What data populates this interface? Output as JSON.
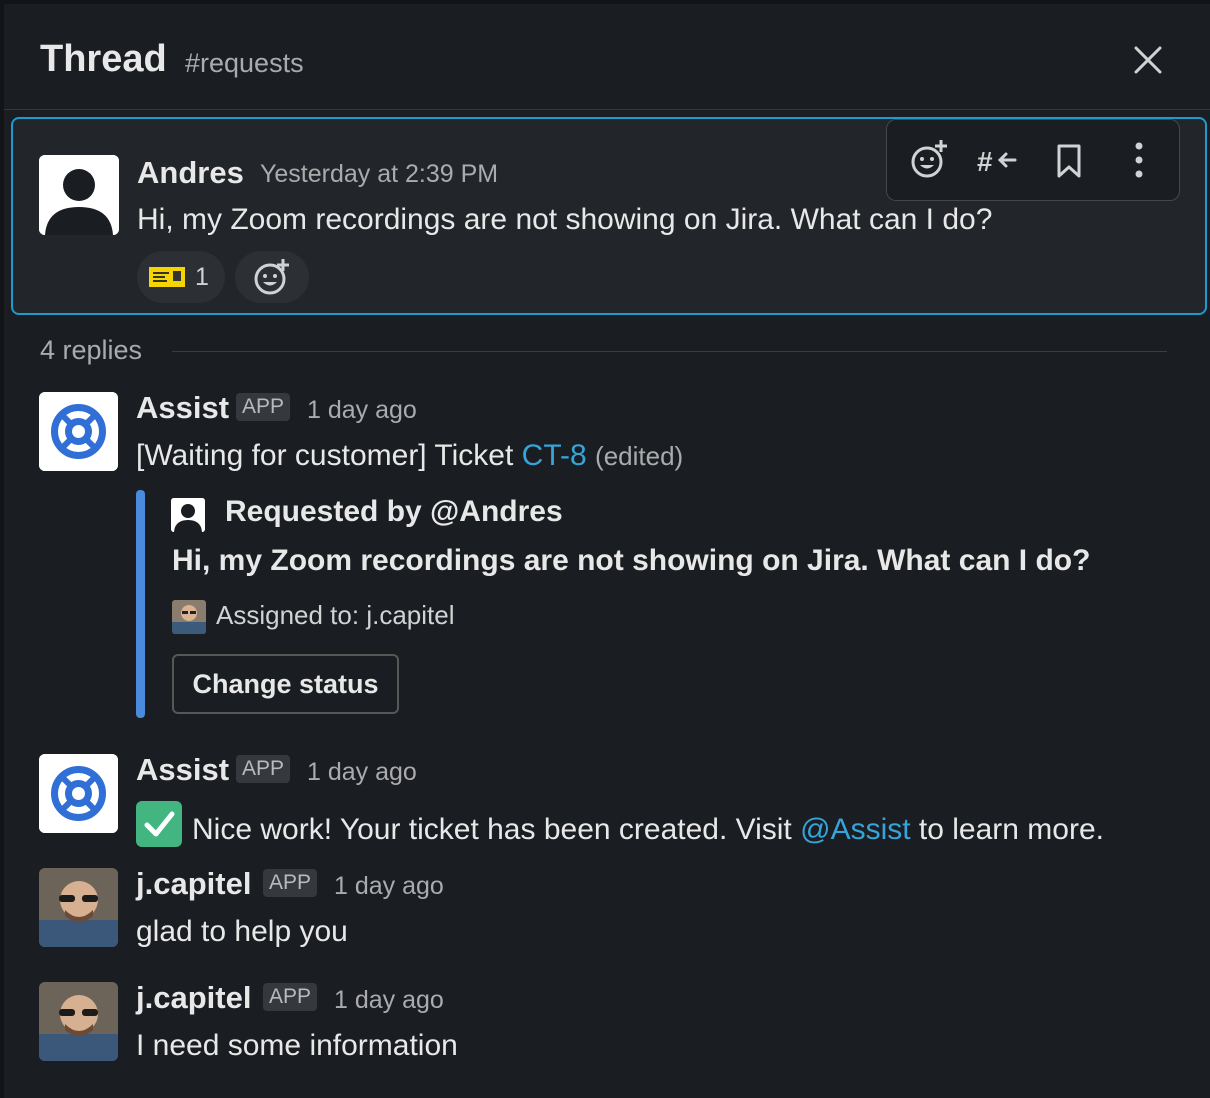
{
  "header": {
    "title": "Thread",
    "channel": "#requests"
  },
  "parent": {
    "author": "Andres",
    "time": "Yesterday at 2:39 PM",
    "text": "Hi, my Zoom recordings are not showing on Jira. What can I do?",
    "reaction": {
      "emoji": "ticket-icon",
      "count": "1"
    }
  },
  "toolbar": [
    "add-reaction-icon",
    "share-to-channel-icon",
    "bookmark-icon",
    "more-actions-icon"
  ],
  "replies": {
    "count_label": "4 replies"
  },
  "messages": [
    {
      "author": "Assist",
      "badge": "APP",
      "time": "1 day ago",
      "text_prefix": "[Waiting for customer] Ticket ",
      "ticket_link": "CT-8",
      "edited": "(edited)",
      "attachment": {
        "requested": "Requested by @Andres",
        "body": "Hi, my Zoom recordings are not showing on Jira. What can I do?",
        "assigned": "Assigned to: j.capitel",
        "button": "Change status"
      }
    },
    {
      "author": "Assist",
      "badge": "APP",
      "time": "1 day ago",
      "text_prefix": "Nice work! Your ticket has been created. Visit ",
      "mention": "@Assist",
      "text_suffix": " to learn more."
    },
    {
      "author": "j.capitel",
      "badge": "APP",
      "time": "1 day ago",
      "text": "glad to help you"
    },
    {
      "author": "j.capitel",
      "badge": "APP",
      "time": "1 day ago",
      "text": "I need some information"
    }
  ],
  "colors": {
    "background": "#1a1d21",
    "highlight_border": "#1d9bd1",
    "link": "#36a3d9",
    "attachment_bar": "#4a8cdb",
    "check": "#43b581"
  }
}
